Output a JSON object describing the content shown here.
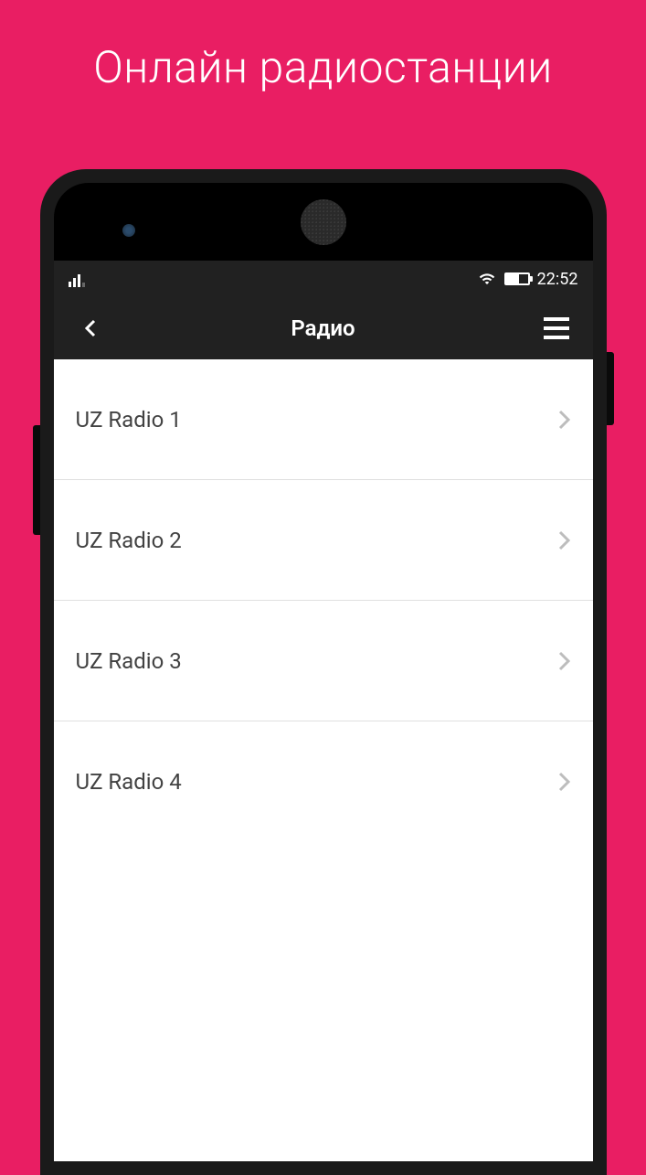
{
  "page": {
    "title": "Онлайн радиостанции"
  },
  "status_bar": {
    "time": "22:52"
  },
  "app_bar": {
    "title": "Радио"
  },
  "radio_list": [
    {
      "label": "UZ Radio 1"
    },
    {
      "label": "UZ Radio 2"
    },
    {
      "label": "UZ Radio 3"
    },
    {
      "label": "UZ Radio 4"
    }
  ]
}
